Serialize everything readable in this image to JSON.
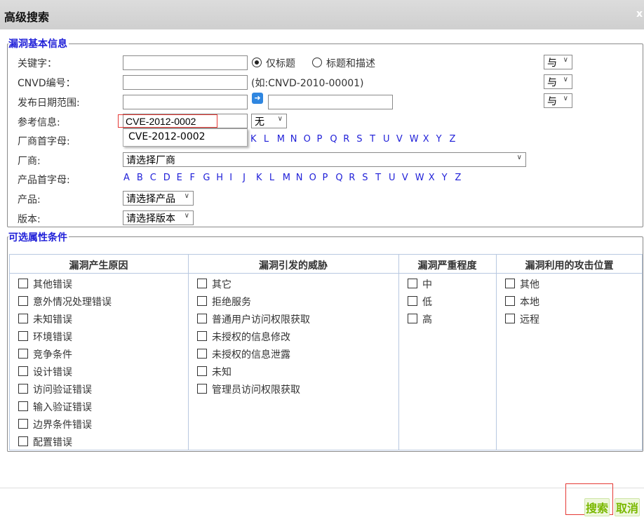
{
  "dialog": {
    "title": "高级搜索",
    "close": "x"
  },
  "basic": {
    "legend": "漏洞基本信息",
    "keyword": {
      "label": "关键字：",
      "value": "",
      "radio_title_only": "仅标题",
      "radio_title_desc": "标题和描述",
      "selected": "仅标题",
      "logic": "与"
    },
    "cnvd": {
      "label": "CNVD编号：",
      "value": "",
      "hint": "(如:CNVD-2010-00001)",
      "logic": "与"
    },
    "date": {
      "label": "发布日期范围:",
      "from": "",
      "to": "",
      "logic": "与"
    },
    "reference": {
      "label": "参考信息:",
      "value": "CVE-2012-0002",
      "type": "无",
      "autocomplete": [
        "CVE-2012-0002"
      ]
    },
    "vendor_letter": {
      "label": "厂商首字母:",
      "letters": [
        "K",
        "L",
        "M",
        "N",
        "O",
        "P",
        "Q",
        "R",
        "S",
        "T",
        "U",
        "V",
        "W",
        "X",
        "Y",
        "Z"
      ]
    },
    "vendor": {
      "label": "厂商:",
      "value": "请选择厂商"
    },
    "product_letter": {
      "label": "产品首字母:",
      "letters": [
        "A",
        "B",
        "C",
        "D",
        "E",
        "F",
        "G",
        "H",
        "I",
        "J",
        "K",
        "L",
        "M",
        "N",
        "O",
        "P",
        "Q",
        "R",
        "S",
        "T",
        "U",
        "V",
        "W",
        "X",
        "Y",
        "Z"
      ]
    },
    "product": {
      "label": "产品:",
      "value": "请选择产品"
    },
    "version": {
      "label": "版本:",
      "value": "请选择版本"
    }
  },
  "optional": {
    "legend": "可选属性条件",
    "columns": [
      {
        "header": "漏洞产生原因",
        "items": [
          "其他错误",
          "意外情况处理错误",
          "未知错误",
          "环境错误",
          "竞争条件",
          "设计错误",
          "访问验证错误",
          "输入验证错误",
          "边界条件错误",
          "配置错误"
        ]
      },
      {
        "header": "漏洞引发的威胁",
        "items": [
          "其它",
          "拒绝服务",
          "普通用户访问权限获取",
          "未授权的信息修改",
          "未授权的信息泄露",
          "未知",
          "管理员访问权限获取"
        ]
      },
      {
        "header": "漏洞严重程度",
        "items": [
          "中",
          "低",
          "高"
        ]
      },
      {
        "header": "漏洞利用的攻击位置",
        "items": [
          "其他",
          "本地",
          "远程"
        ]
      }
    ]
  },
  "buttons": {
    "search": "搜索",
    "cancel": "取消"
  },
  "colors": {
    "accent": "#1f1fd8",
    "button_text": "#7ab800",
    "highlight": "#e53935"
  }
}
